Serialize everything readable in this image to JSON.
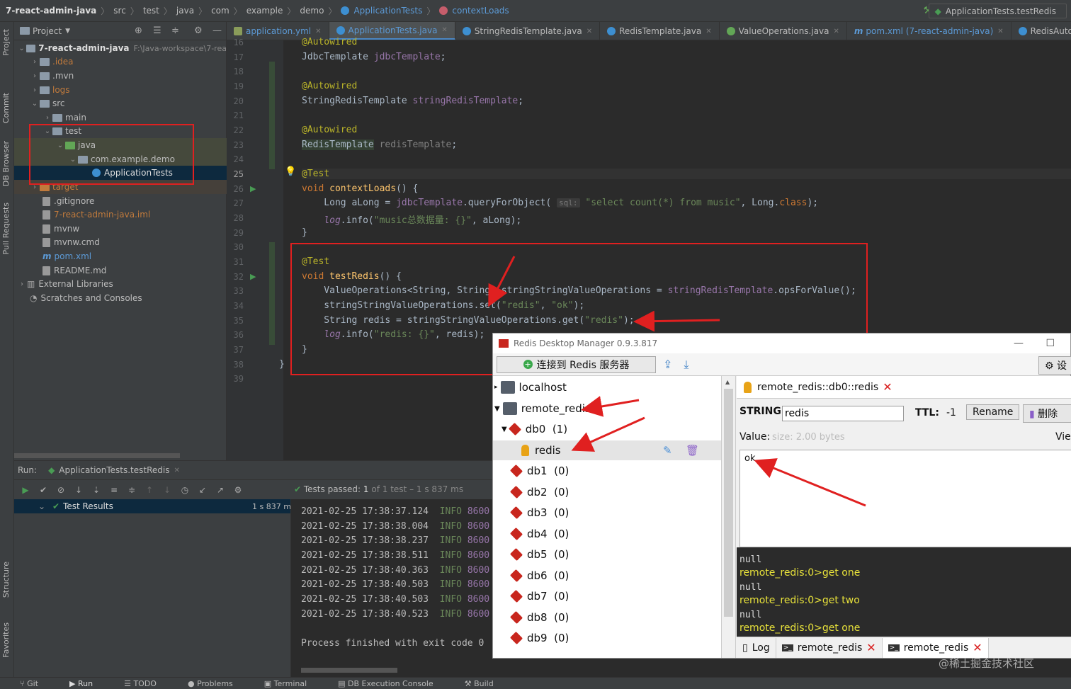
{
  "navbar": {
    "crumbs": [
      "7-react-admin-java",
      "src",
      "test",
      "java",
      "com",
      "example",
      "demo",
      "ApplicationTests",
      "contextLoads"
    ],
    "run_config": "ApplicationTests.testRedis"
  },
  "toolstrip": {
    "project": "Project",
    "commit": "Commit",
    "db_browser": "DB Browser",
    "pull_requests": "Pull Requests",
    "structure": "Structure",
    "favorites": "Favorites"
  },
  "project": {
    "title": "Project",
    "items": [
      {
        "label": "7-react-admin-java",
        "path": "F:\\Java-workspace\\7-rea"
      },
      {
        "label": ".idea"
      },
      {
        "label": ".mvn"
      },
      {
        "label": "logs"
      },
      {
        "label": "src"
      },
      {
        "label": "main"
      },
      {
        "label": "test"
      },
      {
        "label": "java"
      },
      {
        "label": "com.example.demo"
      },
      {
        "label": "ApplicationTests"
      },
      {
        "label": "target"
      },
      {
        "label": ".gitignore"
      },
      {
        "label": "7-react-admin-java.iml"
      },
      {
        "label": "mvnw"
      },
      {
        "label": "mvnw.cmd"
      },
      {
        "label": "pom.xml"
      },
      {
        "label": "README.md"
      },
      {
        "label": "External Libraries"
      },
      {
        "label": "Scratches and Consoles"
      }
    ]
  },
  "tabs": [
    "application.yml",
    "ApplicationTests.java",
    "StringRedisTemplate.java",
    "RedisTemplate.java",
    "ValueOperations.java",
    "pom.xml (7-react-admin-java)",
    "RedisAutoConfigurati"
  ],
  "code": {
    "line_numbers": [
      "16",
      "17",
      "18",
      "19",
      "20",
      "21",
      "22",
      "23",
      "24",
      "25",
      "26",
      "27",
      "28",
      "29",
      "30",
      "31",
      "32",
      "33",
      "34",
      "35",
      "36",
      "37",
      "38",
      "39"
    ]
  },
  "run": {
    "label": "Run:",
    "config": "ApplicationTests.testRedis",
    "tests_passed": "Tests passed:",
    "tests_count": "1",
    "tests_detail": "of 1 test – 1 s 837 ms",
    "results_label": "Test Results",
    "results_time": "1 s 837 ms",
    "logs": [
      {
        "time": "2021-02-25 17:38:37.124",
        "level": "INFO",
        "pid": "8600"
      },
      {
        "time": "2021-02-25 17:38:38.004",
        "level": "INFO",
        "pid": "8600"
      },
      {
        "time": "2021-02-25 17:38:38.237",
        "level": "INFO",
        "pid": "8600"
      },
      {
        "time": "2021-02-25 17:38:38.511",
        "level": "INFO",
        "pid": "8600"
      },
      {
        "time": "2021-02-25 17:38:40.363",
        "level": "INFO",
        "pid": "8600"
      },
      {
        "time": "2021-02-25 17:38:40.503",
        "level": "INFO",
        "pid": "8600"
      },
      {
        "time": "2021-02-25 17:38:40.503",
        "level": "INFO",
        "pid": "8600"
      },
      {
        "time": "2021-02-25 17:38:40.523",
        "level": "INFO",
        "pid": "8600"
      }
    ],
    "finished": "Process finished with exit code 0"
  },
  "statusbar": [
    "Git",
    "Run",
    "TODO",
    "Problems",
    "Terminal",
    "DB Execution Console",
    "Build"
  ],
  "rdm": {
    "title": "Redis Desktop Manager 0.9.3.817",
    "connect": "连接到 Redis 服务器",
    "settings": "设",
    "tree": {
      "localhost": "localhost",
      "remote": "remote_redis",
      "db0": "db0",
      "db0_count": "(1)",
      "key": "redis",
      "dbs": [
        {
          "name": "db1",
          "count": "(0)"
        },
        {
          "name": "db2",
          "count": "(0)"
        },
        {
          "name": "db3",
          "count": "(0)"
        },
        {
          "name": "db4",
          "count": "(0)"
        },
        {
          "name": "db5",
          "count": "(0)"
        },
        {
          "name": "db6",
          "count": "(0)"
        },
        {
          "name": "db7",
          "count": "(0)"
        },
        {
          "name": "db8",
          "count": "(0)"
        },
        {
          "name": "db9",
          "count": "(0)"
        }
      ]
    },
    "key_tab": "remote_redis::db0::redis",
    "type_label": "STRING:",
    "key_value": "redis",
    "ttl_label": "TTL:",
    "ttl": "-1",
    "rename": "Rename",
    "delete": "删除",
    "value_label": "Value:",
    "value_size": "size: 2.00 bytes",
    "view": "Vie",
    "value": "ok",
    "console": [
      "null",
      "remote_redis:0>get one",
      "null",
      "remote_redis:0>get two",
      "null",
      "remote_redis:0>get  one"
    ],
    "bottom_tabs": [
      "Log",
      "remote_redis",
      "remote_redis"
    ]
  },
  "watermark": "@稀土掘金技术社区"
}
